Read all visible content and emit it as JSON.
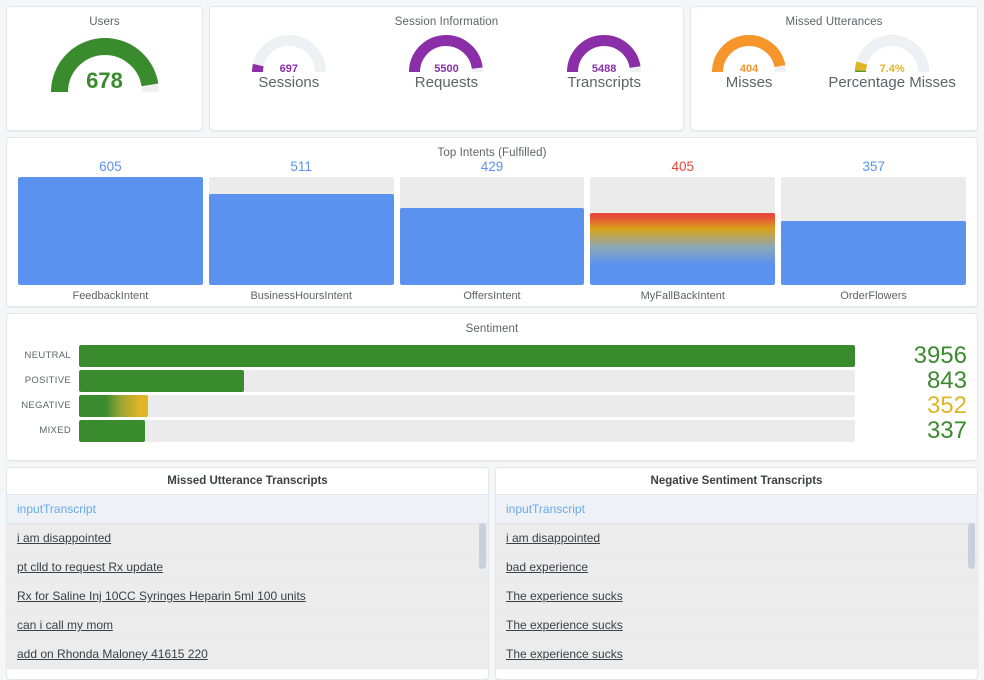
{
  "colors": {
    "green": "#3a8a2e",
    "purple": "#8b2fa8",
    "orange": "#f5952a",
    "blue": "#5b92f0",
    "red": "#e8483a",
    "gold": "#e0b427",
    "track": "#ebebeb",
    "gauge_track": "#eef0f4"
  },
  "users_panel": {
    "title": "Users",
    "gauge": {
      "value": "678",
      "label": "",
      "percent": 95,
      "color": "#3a8a2e",
      "size": "large"
    }
  },
  "session_panel": {
    "title": "Session Information",
    "gauges": [
      {
        "value": "697",
        "label": "Sessions",
        "percent": 7,
        "color": "#8b2fa8"
      },
      {
        "value": "5500",
        "label": "Requests",
        "percent": 96,
        "color": "#8b2fa8"
      },
      {
        "value": "5488",
        "label": "Transcripts",
        "percent": 95,
        "color": "#8b2fa8"
      }
    ]
  },
  "missed_panel": {
    "title": "Missed Utterances",
    "gauges": [
      {
        "value": "404",
        "label": "Misses",
        "percent": 94,
        "color": "#f5952a"
      },
      {
        "value": "7.4%",
        "label": "Percentage Misses",
        "percent": 9,
        "color": "#e0b427",
        "ring": "#e8354a"
      }
    ]
  },
  "chart_data": [
    {
      "type": "bar",
      "title": "Top Intents (Fulfilled)",
      "categories": [
        "FeedbackIntent",
        "BusinessHoursIntent",
        "OffersIntent",
        "MyFallBackIntent",
        "OrderFlowers"
      ],
      "values": [
        605,
        511,
        429,
        405,
        357
      ],
      "value_labels": [
        "605",
        "511",
        "429",
        "405",
        "357"
      ],
      "label_colors": [
        "#5b92f0",
        "#5b92f0",
        "#5b92f0",
        "#e8483a",
        "#5b92f0"
      ],
      "bar_styles": [
        "solid",
        "solid",
        "solid",
        "gradient",
        "solid"
      ],
      "xlabel": "",
      "ylabel": "",
      "ylim": [
        0,
        605
      ],
      "grid": false,
      "legend": "none"
    },
    {
      "type": "bar",
      "orientation": "horizontal",
      "title": "Sentiment",
      "categories": [
        "NEUTRAL",
        "POSITIVE",
        "NEGATIVE",
        "MIXED"
      ],
      "values": [
        3956,
        843,
        352,
        337
      ],
      "value_labels": [
        "3956",
        "843",
        "352",
        "337"
      ],
      "value_colors": [
        "#3a8a2e",
        "#3a8a2e",
        "#e0b427",
        "#3a8a2e"
      ],
      "bar_styles": [
        "solid",
        "solid",
        "gradient",
        "solid"
      ],
      "xlabel": "",
      "ylabel": "",
      "xlim": [
        0,
        3956
      ],
      "grid": false,
      "legend": "none"
    }
  ],
  "intents": {
    "title": "Top Intents (Fulfilled)",
    "bars": [
      {
        "value": "605",
        "name": "FeedbackIntent",
        "pct": 100,
        "label_color": "#5b92f0",
        "style": "solid"
      },
      {
        "value": "511",
        "name": "BusinessHoursIntent",
        "pct": 84,
        "label_color": "#5b92f0",
        "style": "solid"
      },
      {
        "value": "429",
        "name": "OffersIntent",
        "pct": 71,
        "label_color": "#5b92f0",
        "style": "solid"
      },
      {
        "value": "405",
        "name": "MyFallBackIntent",
        "pct": 67,
        "label_color": "#e8483a",
        "style": "gradient"
      },
      {
        "value": "357",
        "name": "OrderFlowers",
        "pct": 59,
        "label_color": "#5b92f0",
        "style": "solid"
      }
    ]
  },
  "sentiment": {
    "title": "Sentiment",
    "rows": [
      {
        "label": "NEUTRAL",
        "value": "3956",
        "pct": 100,
        "color": "#3a8a2e",
        "style": "solid"
      },
      {
        "label": "POSITIVE",
        "value": "843",
        "pct": 21.3,
        "color": "#3a8a2e",
        "style": "solid"
      },
      {
        "label": "NEGATIVE",
        "value": "352",
        "pct": 8.9,
        "color": "#e0b427",
        "style": "gradient"
      },
      {
        "label": "MIXED",
        "value": "337",
        "pct": 8.5,
        "color": "#3a8a2e",
        "style": "solid"
      }
    ]
  },
  "missed_table": {
    "title": "Missed Utterance Transcripts",
    "column": "inputTranscript",
    "rows": [
      "i am disappointed",
      "pt clld to request Rx update",
      "Rx for Saline Inj 10CC Syringes Heparin 5ml 100 units",
      "can i call my mom",
      "add on Rhonda Maloney 41615 220"
    ]
  },
  "negative_table": {
    "title": "Negative Sentiment Transcripts",
    "column": "inputTranscript",
    "rows": [
      "i am disappointed",
      "bad experience",
      "The experience sucks",
      "The experience sucks",
      "The experience sucks"
    ]
  }
}
